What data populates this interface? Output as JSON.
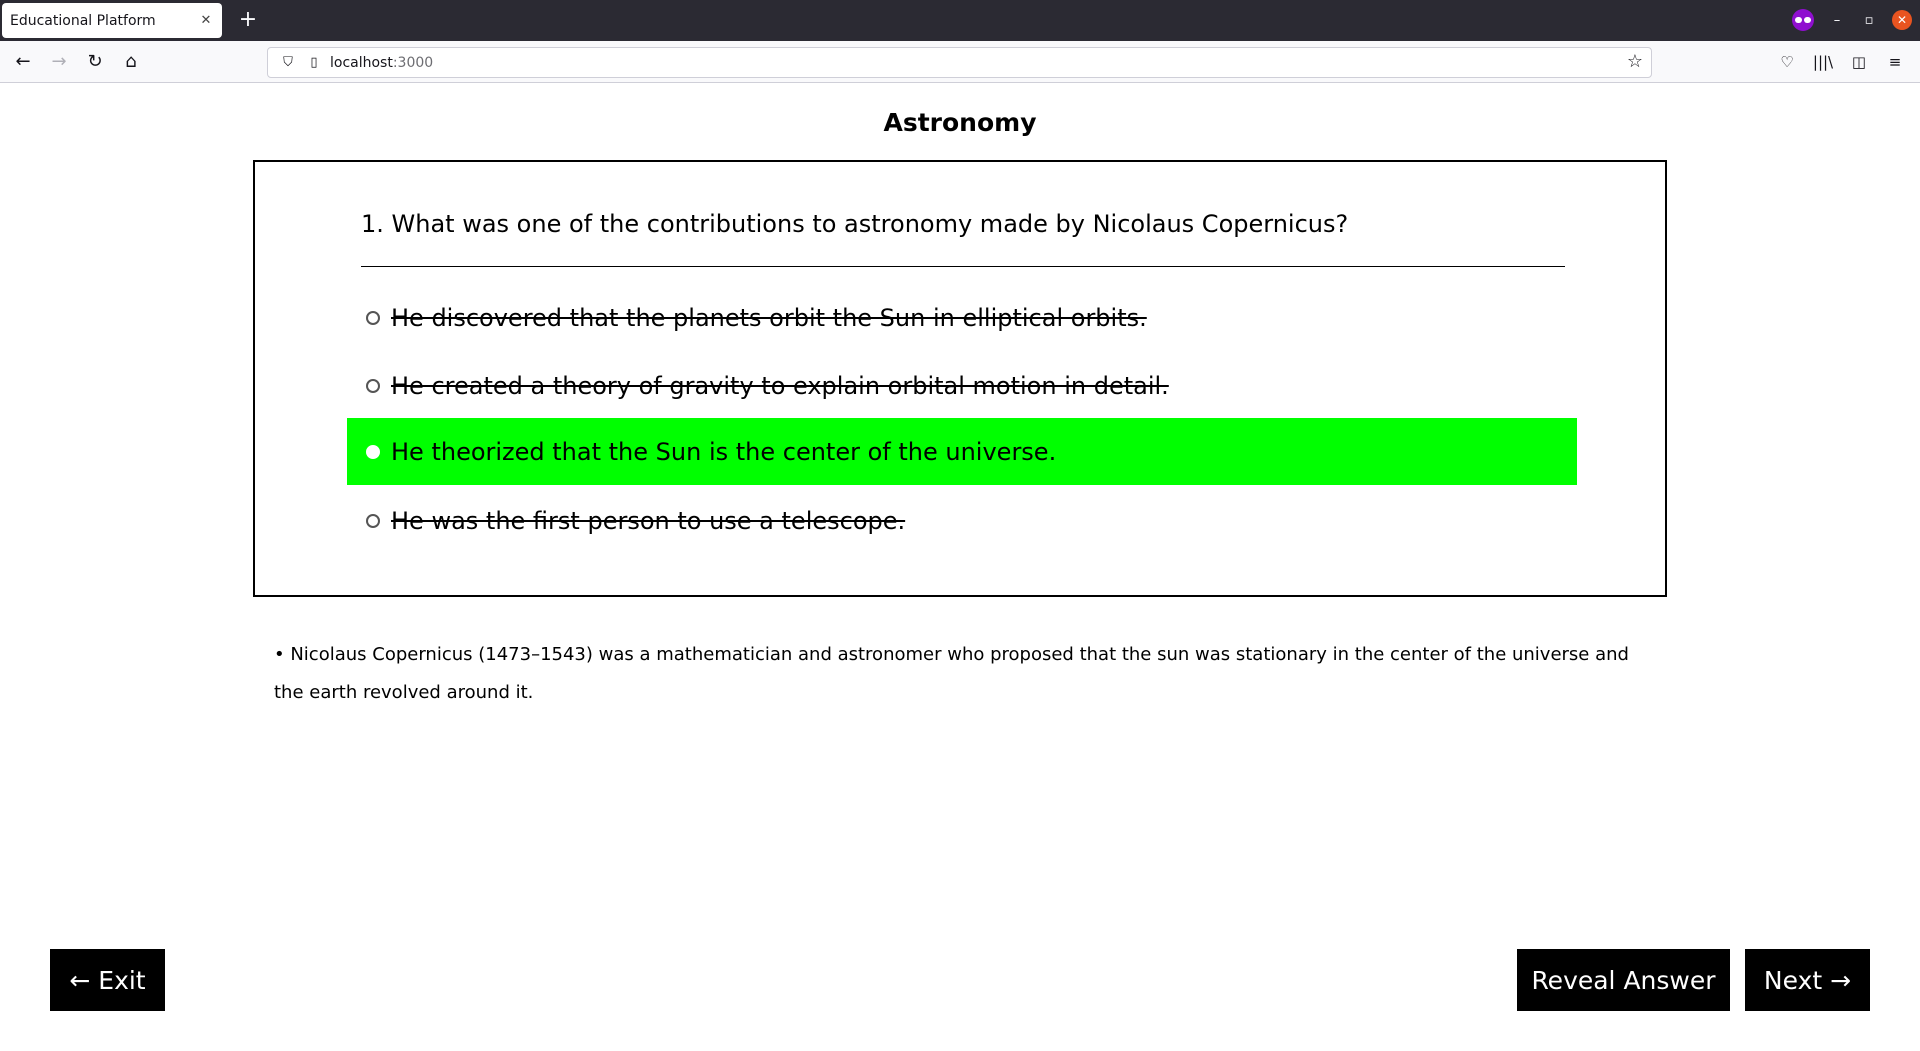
{
  "browser": {
    "tab_title": "Educational Platform",
    "tab_close": "✕",
    "new_tab": "+",
    "url_host": "localhost",
    "url_port": ":3000",
    "icons": {
      "back": "←",
      "forward": "→",
      "reload": "↻",
      "home": "⌂",
      "shield": "⛉",
      "page": "▯",
      "star": "☆",
      "pocket": "♡",
      "library": "|||\\",
      "sidebar": "◫",
      "menu": "≡",
      "minimize": "–",
      "restore": "▫",
      "close": "✕"
    }
  },
  "page": {
    "title": "Astronomy",
    "question": "1. What was one of the contributions to astronomy made by Nicolaus Copernicus?",
    "options": [
      {
        "text": "He discovered that the planets orbit the Sun in elliptical orbits.",
        "state": "struck"
      },
      {
        "text": "He created a theory of gravity to explain orbital motion in detail.",
        "state": "struck"
      },
      {
        "text": "He theorized that the Sun is the center of the universe.",
        "state": "correct"
      },
      {
        "text": "He was the first person to use a telescope.",
        "state": "struck"
      }
    ],
    "explanation": "• Nicolaus Copernicus (1473–1543) was a mathematician and astronomer who proposed that the sun was stationary in the center of the universe and the earth revolved around it.",
    "correct_color": "#00ff00"
  },
  "buttons": {
    "exit": "← Exit",
    "reveal": "Reveal Answer",
    "next": "Next →"
  }
}
